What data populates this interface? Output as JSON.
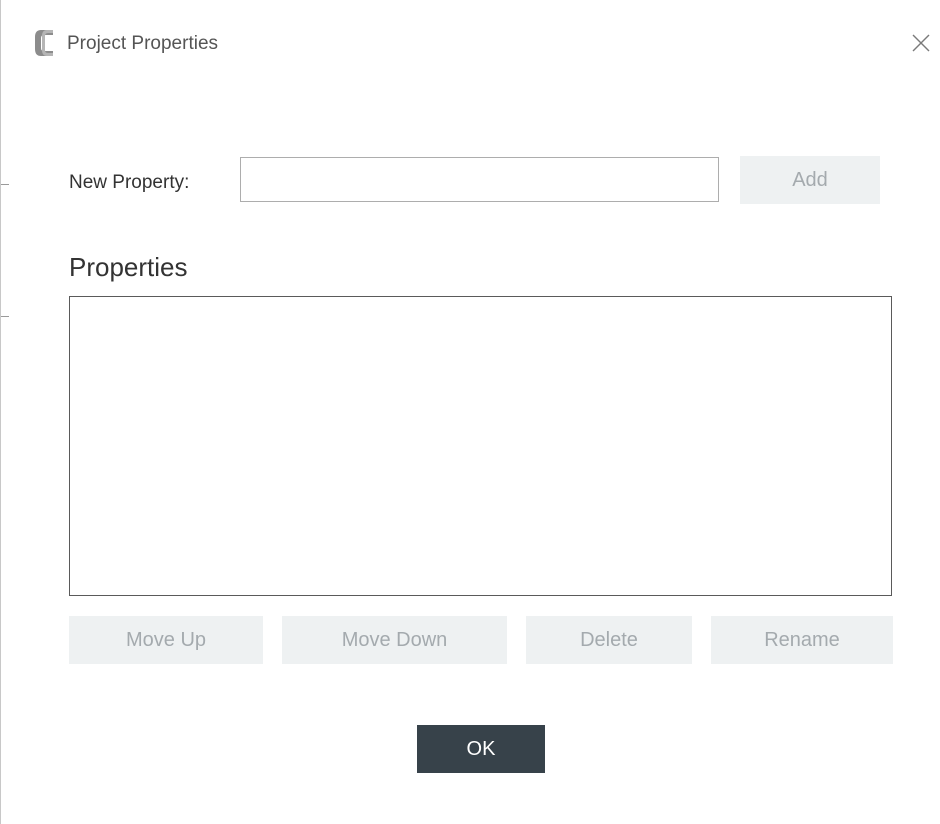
{
  "window": {
    "title": "Project Properties",
    "logo_icon": "app-logo-icon",
    "close_icon": "close-icon"
  },
  "new_property": {
    "label": "New Property:",
    "value": "",
    "placeholder": "",
    "add_label": "Add"
  },
  "properties": {
    "title": "Properties",
    "items": []
  },
  "actions": {
    "move_up_label": "Move Up",
    "move_down_label": "Move Down",
    "delete_label": "Delete",
    "rename_label": "Rename"
  },
  "footer": {
    "ok_label": "OK"
  },
  "colors": {
    "ok_button_bg": "#37424a",
    "disabled_button_bg": "#eef1f2",
    "disabled_button_text": "#a4aaae"
  }
}
